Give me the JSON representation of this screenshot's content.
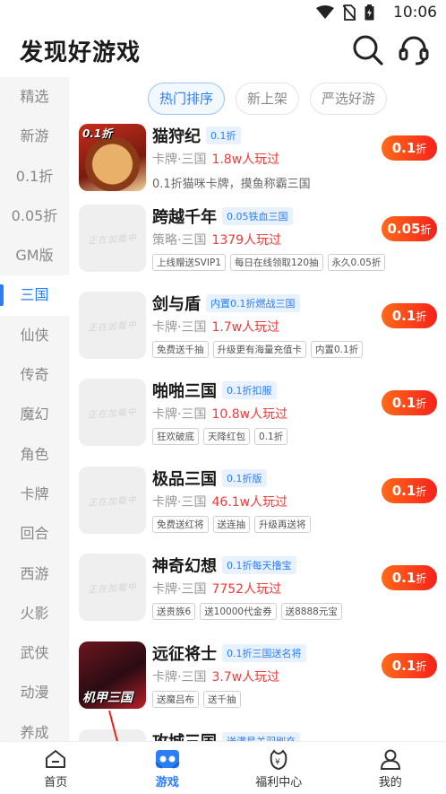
{
  "status": {
    "time": "10:06"
  },
  "header": {
    "title": "发现好游戏"
  },
  "sidebar": {
    "items": [
      {
        "label": "精选"
      },
      {
        "label": "新游"
      },
      {
        "label": "0.1折"
      },
      {
        "label": "0.05折"
      },
      {
        "label": "GM版"
      },
      {
        "label": "三国",
        "active": true
      },
      {
        "label": "仙侠"
      },
      {
        "label": "传奇"
      },
      {
        "label": "魔幻"
      },
      {
        "label": "角色"
      },
      {
        "label": "卡牌"
      },
      {
        "label": "回合"
      },
      {
        "label": "西游"
      },
      {
        "label": "火影"
      },
      {
        "label": "武侠"
      },
      {
        "label": "动漫"
      },
      {
        "label": "养成"
      }
    ]
  },
  "tabs": [
    {
      "label": "热门排序",
      "active": true
    },
    {
      "label": "新上架"
    },
    {
      "label": "严选好游"
    }
  ],
  "games": [
    {
      "name": "猫狩纪",
      "tag": "0.1折",
      "category": "卡牌·三国",
      "players": "1.8w人玩过",
      "desc": "0.1折猫咪卡牌，摸鱼称霸三国",
      "discount": "0.1",
      "unit": "折",
      "placeholder": "",
      "icon_text": "0.1折"
    },
    {
      "name": "跨越千年",
      "tag": "0.05铁血三国",
      "category": "策略·三国",
      "players": "1379人玩过",
      "tags": [
        "上线赠送SVIP1",
        "每日在线领取120抽",
        "永久0.05折"
      ],
      "discount": "0.05",
      "unit": "折",
      "placeholder": "正在加载中"
    },
    {
      "name": "剑与盾",
      "tag": "内置0.1折燃战三国",
      "category": "卡牌·三国",
      "players": "1.7w人玩过",
      "tags": [
        "免费送千抽",
        "升级更有海量充值卡",
        "内置0.1折"
      ],
      "discount": "0.1",
      "unit": "折",
      "placeholder": "正在加载中"
    },
    {
      "name": "啪啪三国",
      "tag": "0.1折扣服",
      "category": "卡牌·三国",
      "players": "10.8w人玩过",
      "tags": [
        "狂欢破底",
        "天降红包",
        "0.1折"
      ],
      "discount": "0.1",
      "unit": "折",
      "placeholder": "正在加载中"
    },
    {
      "name": "极品三国",
      "tag": "0.1折版",
      "category": "卡牌·三国",
      "players": "46.1w人玩过",
      "tags": [
        "免费送红将",
        "送连抽",
        "升级再送将"
      ],
      "discount": "0.1",
      "unit": "折",
      "placeholder": "正在加载中"
    },
    {
      "name": "神奇幻想",
      "tag": "0.1折每天撸宝",
      "category": "卡牌·三国",
      "players": "7752人玩过",
      "tags": [
        "送贵族6",
        "送10000代金券",
        "送8888元宝"
      ],
      "discount": "0.1",
      "unit": "折",
      "placeholder": "正在加载中"
    },
    {
      "name": "远征将士",
      "tag": "0.1折三国送名将",
      "category": "卡牌·三国",
      "players": "3.7w人玩过",
      "tags": [
        "送魔吕布",
        "送千抽"
      ],
      "discount": "0.1",
      "unit": "折",
      "placeholder": "",
      "icon_text": "机甲三国"
    },
    {
      "name": "攻城三国",
      "tag": "送满星关羽刷充",
      "category": "",
      "players": "",
      "tags": [],
      "discount": "",
      "unit": "",
      "placeholder": ""
    }
  ],
  "nav": [
    {
      "label": "首页"
    },
    {
      "label": "游戏",
      "active": true
    },
    {
      "label": "福利中心"
    },
    {
      "label": "我的"
    }
  ],
  "colors": {
    "accent": "#2b7ef5",
    "price": "#f5221b",
    "players": "#f23a3a"
  }
}
